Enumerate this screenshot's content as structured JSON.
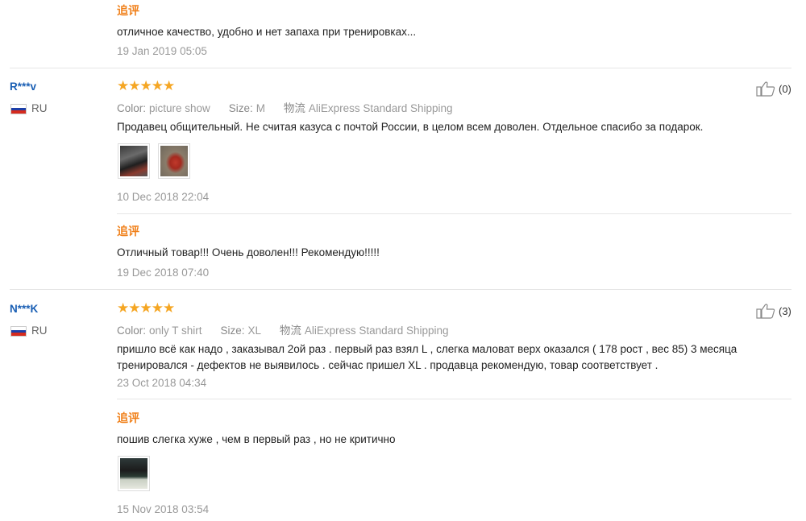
{
  "top_reply": {
    "label": "追评",
    "text": "отличное качество, удобно и нет запаха при тренировках...",
    "date": "19 Jan 2019 05:05"
  },
  "reviews": [
    {
      "user": "R***v",
      "country": "RU",
      "rating": 5,
      "stars": "★★★★★",
      "color_label": "Color:",
      "color_value": "picture show",
      "size_label": "Size:",
      "size_value": "M",
      "logistics_label": "物流",
      "logistics_value": "AliExpress Standard Shipping",
      "text": "Продавец общительный. Не считая казуса с почтой России, в целом всем доволен. Отдельное спасибо за подарок.",
      "date": "10 Dec 2018 22:04",
      "helpful_count": "(0)",
      "followup": {
        "label": "追评",
        "text": "Отличный товар!!! Очень доволен!!! Рекомендую!!!!!",
        "date": "19 Dec 2018 07:40"
      }
    },
    {
      "user": "N***K",
      "country": "RU",
      "rating": 5,
      "stars": "★★★★★",
      "color_label": "Color:",
      "color_value": "only T shirt",
      "size_label": "Size:",
      "size_value": "XL",
      "logistics_label": "物流",
      "logistics_value": "AliExpress Standard Shipping",
      "text": "пришло всё как надо , заказывал 2ой раз . первый раз взял L , слегка маловат верх оказался ( 178 рост , вес 85) 3 месяца тренировался - дефектов не выявилось . сейчас пришел XL . продавца рекомендую, товар соответствует .",
      "date": "23 Oct 2018 04:34",
      "helpful_count": "(3)",
      "followup": {
        "label": "追评",
        "text": "пошив слегка хуже , чем в первый раз , но не критично",
        "date": "15 Nov 2018 03:54"
      }
    }
  ],
  "icons": {
    "thumbs_up": "thumbs-up-icon",
    "flag": "russia-flag-icon"
  },
  "colors": {
    "accent_orange": "#f0801a",
    "star": "#f5a623",
    "username_blue": "#1a5fb4",
    "muted": "#999999"
  }
}
